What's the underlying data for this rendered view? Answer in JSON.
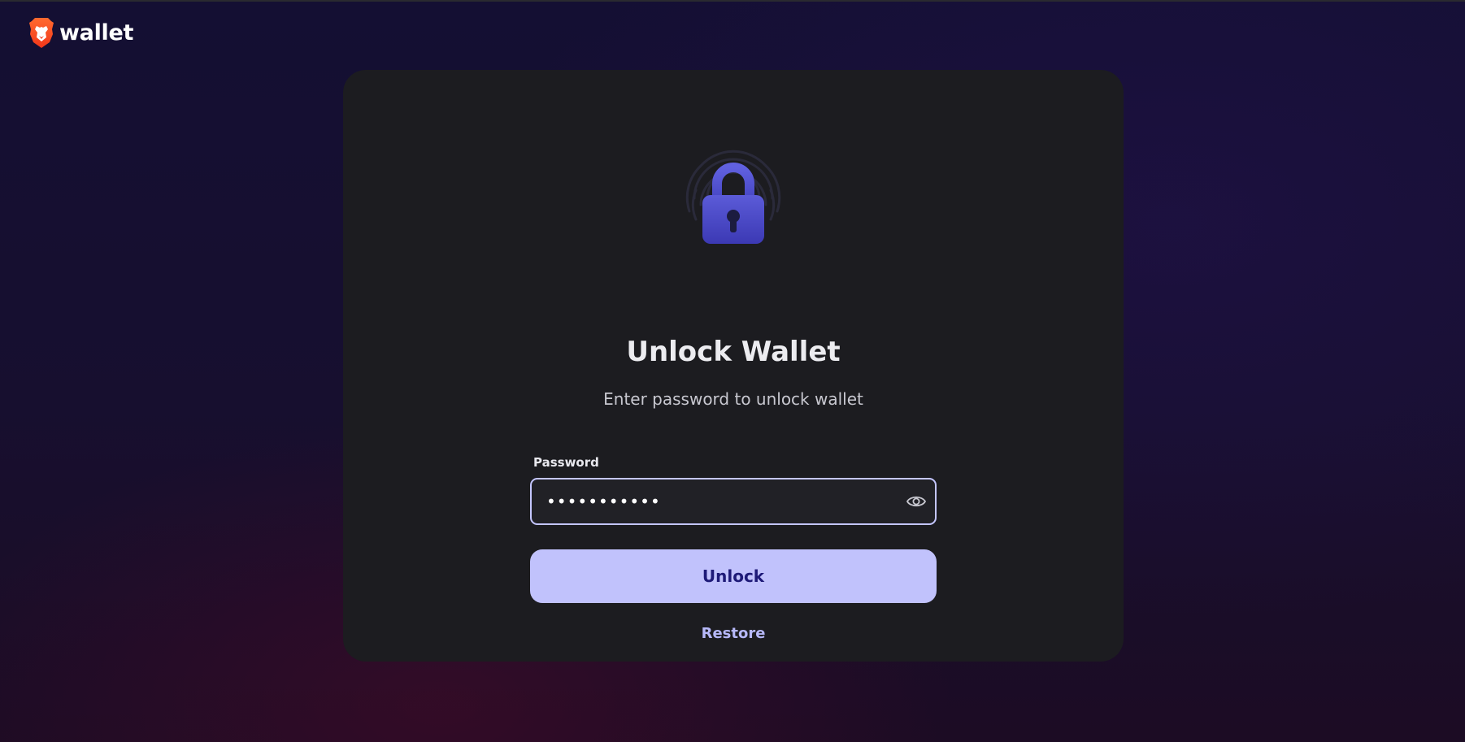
{
  "brand": {
    "name": "wallet",
    "logo_icon": "brave-lion-icon",
    "logo_color": "#fb542b"
  },
  "unlock": {
    "title": "Unlock Wallet",
    "subtitle": "Enter password to unlock wallet",
    "illustration_icon": "padlock-fingerprint-icon",
    "password": {
      "label": "Password",
      "value": "•••••••••••",
      "visibility_icon": "eye-icon"
    },
    "unlock_label": "Unlock",
    "restore_label": "Restore"
  },
  "colors": {
    "accent": "#c1c2fc",
    "accent_text": "#1e1a78",
    "card": "#1c1c20",
    "link": "#b6b8f8"
  }
}
